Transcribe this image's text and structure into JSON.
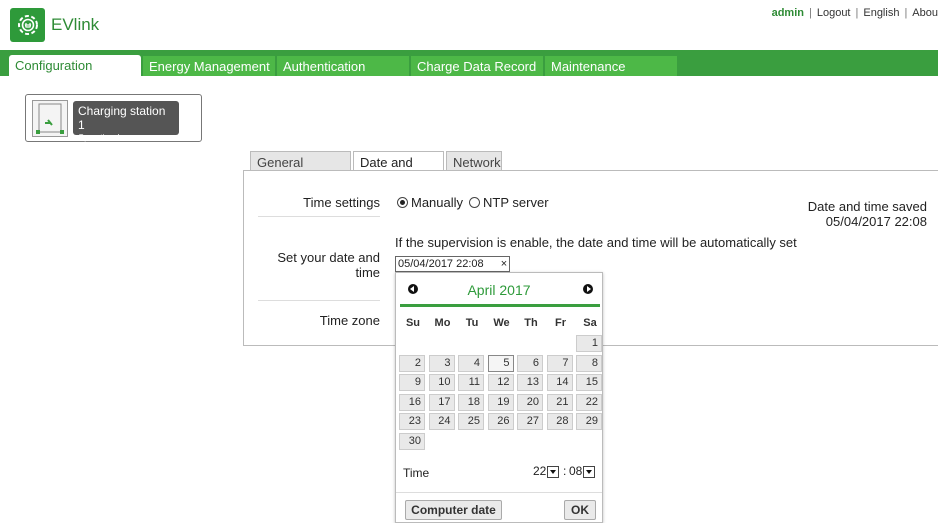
{
  "app": {
    "title": "EVlink",
    "logo_icon": "gear-plug-icon",
    "accent": "#3a9e3f"
  },
  "topnav": {
    "user": "admin",
    "logout": "Logout",
    "language": "English",
    "about": "Abou"
  },
  "tabs": [
    {
      "label": "Configuration",
      "active": true
    },
    {
      "label": "Energy Management"
    },
    {
      "label": "Authentication"
    },
    {
      "label": "Charge Data Record"
    },
    {
      "label": "Maintenance"
    }
  ],
  "station": {
    "name": "Charging station 1",
    "status": "Operational",
    "icon": "charging-station-icon"
  },
  "subtabs": [
    {
      "label": "General Settings"
    },
    {
      "label": "Date and Time",
      "active": true
    },
    {
      "label": "Network"
    }
  ],
  "form": {
    "time_settings_label": "Time settings",
    "option_manual": "Manually",
    "option_ntp": "NTP server",
    "selected_option": "Manually",
    "date_label_line1": "Set your date and",
    "date_label_line2": "time",
    "date_value": "05/04/2017 22:08",
    "clear_symbol": "×",
    "timezone_label": "Time zone",
    "note": "If the supervision is enable, the date and time will be automatically set",
    "saved_label": "Date and time saved",
    "saved_value": "05/04/2017 22:08"
  },
  "calendar": {
    "month_title": "April 2017",
    "weekdays": [
      "Su",
      "Mo",
      "Tu",
      "We",
      "Th",
      "Fr",
      "Sa"
    ],
    "weeks": [
      [
        "",
        "",
        "",
        "",
        "",
        "",
        "1"
      ],
      [
        "2",
        "3",
        "4",
        "5",
        "6",
        "7",
        "8"
      ],
      [
        "9",
        "10",
        "11",
        "12",
        "13",
        "14",
        "15"
      ],
      [
        "16",
        "17",
        "18",
        "19",
        "20",
        "21",
        "22"
      ],
      [
        "23",
        "24",
        "25",
        "26",
        "27",
        "28",
        "29"
      ],
      [
        "30",
        "",
        "",
        "",
        "",
        "",
        ""
      ]
    ],
    "today": "5",
    "time_label": "Time",
    "hour": "22",
    "minute": "08",
    "separator": ":",
    "computer_date_button": "Computer date",
    "ok_button": "OK"
  }
}
